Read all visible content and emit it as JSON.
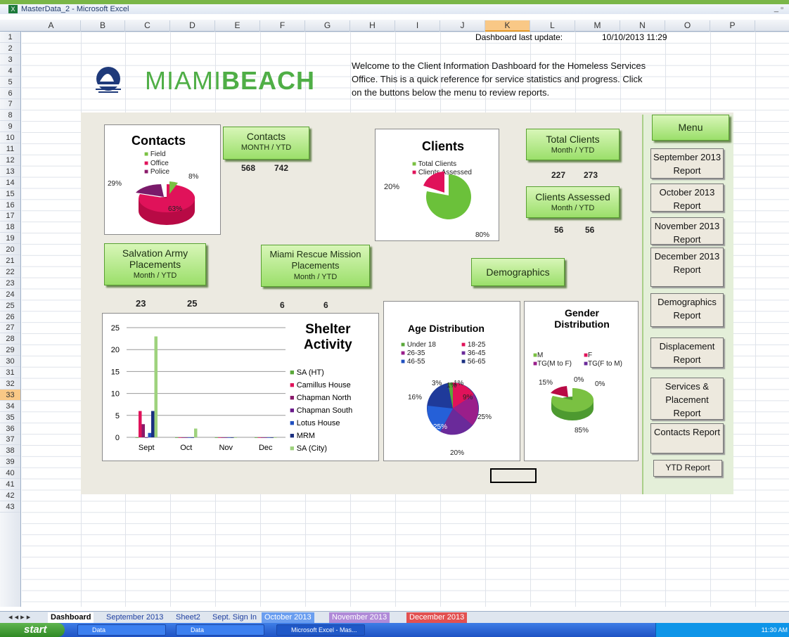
{
  "window": {
    "title": "MasterData_2 - Microsoft Excel"
  },
  "columns": [
    "A",
    "B",
    "C",
    "D",
    "E",
    "F",
    "G",
    "H",
    "I",
    "J",
    "K",
    "L",
    "M",
    "N",
    "O",
    "P"
  ],
  "selected_column": "K",
  "rows": [
    "1",
    "2",
    "3",
    "4",
    "5",
    "6",
    "7",
    "8",
    "9",
    "10",
    "11",
    "12",
    "13",
    "14",
    "15",
    "16",
    "17",
    "18",
    "19",
    "20",
    "21",
    "22",
    "23",
    "24",
    "25",
    "26",
    "27",
    "28",
    "29",
    "30",
    "31",
    "32",
    "33",
    "34",
    "35",
    "36",
    "37",
    "38",
    "39",
    "40",
    "41",
    "42",
    "43"
  ],
  "selected_row": "33",
  "header": {
    "update_label": "Dashboard last update:",
    "update_value": "10/10/2013 11:29",
    "logo_text_a": "MIAMI",
    "logo_text_b": "BEACH",
    "welcome": "Welcome to the Client Information Dashboard for the Homeless Services Office. This is a quick reference for service statistics and progress.  Click on the buttons below the menu to review reports."
  },
  "contacts": {
    "title": "Contacts",
    "legend": [
      "Field",
      "Office",
      "Police"
    ],
    "labels": [
      "8%",
      "63%",
      "29%"
    ],
    "btn_label": "Contacts",
    "btn_sub": "MONTH / YTD",
    "month": "568",
    "ytd": "742"
  },
  "clients": {
    "title": "Clients",
    "legend": [
      "Total Clients",
      "Clients Assessed"
    ],
    "labels": [
      "20%",
      "80%"
    ],
    "total_btn": "Total Clients",
    "total_sub": "Month  /  YTD",
    "total_month": "227",
    "total_ytd": "273",
    "assessed_btn": "Clients Assessed",
    "assessed_sub": "Month  /  YTD",
    "assessed_month": "56",
    "assessed_ytd": "56"
  },
  "salvation": {
    "btn_line1": "Salvation Army",
    "btn_line2": "Placements",
    "btn_sub": "Month  /   YTD",
    "month": "23",
    "ytd": "25"
  },
  "rescue": {
    "btn_line1": "Miami Rescue Mission",
    "btn_line2": "Placements",
    "btn_sub": "Month   /   YTD",
    "month": "6",
    "ytd": "6"
  },
  "demographics_btn": "Demographics",
  "shelter": {
    "title_line1": "Shelter",
    "title_line2": "Activity"
  },
  "age": {
    "title": "Age Distribution",
    "legend": [
      "Under 18",
      "18-25",
      "26-35",
      "36-45",
      "46-55",
      "56-65"
    ],
    "labels": [
      "1%",
      "3%",
      "1%",
      "16%",
      "9%",
      "25%",
      "25%",
      "20%"
    ]
  },
  "gender": {
    "title_line1": "Gender",
    "title_line2": "Distribution",
    "legend": [
      "M",
      "F",
      "TG(M to F)",
      "TG(F to M)"
    ],
    "labels": [
      "15%",
      "0%",
      "0%",
      "85%"
    ]
  },
  "chart_data": {
    "type": "bar",
    "categories": [
      "Sept",
      "Oct",
      "Nov",
      "Dec"
    ],
    "ylim": [
      0,
      25
    ],
    "yticks": [
      "0",
      "5",
      "10",
      "15",
      "20",
      "25"
    ],
    "series": [
      {
        "name": "SA (HT)",
        "color": "#5aa83a",
        "values": [
          0,
          0,
          0,
          0
        ]
      },
      {
        "name": "Camillus House",
        "color": "#e0125a",
        "values": [
          6,
          0,
          0,
          0
        ]
      },
      {
        "name": "Chapman North",
        "color": "#8a1a6a",
        "values": [
          3,
          0,
          0,
          0
        ]
      },
      {
        "name": "Chapman South",
        "color": "#6a1a8a",
        "values": [
          0,
          0,
          0,
          0
        ]
      },
      {
        "name": "Lotus House",
        "color": "#2050c0",
        "values": [
          1,
          0,
          0,
          0
        ]
      },
      {
        "name": "MRM",
        "color": "#1a2f80",
        "values": [
          6,
          0,
          0,
          0
        ]
      },
      {
        "name": "SA (City)",
        "color": "#9ed27d",
        "values": [
          23,
          2,
          0,
          0
        ]
      }
    ]
  },
  "menu": {
    "title": "Menu",
    "items": [
      "September 2013 Report",
      "October 2013 Report",
      "November 2013 Report",
      "December 2013 Report",
      "Demographics Report",
      "Displacement Report",
      "Services & Placement Report",
      "Contacts Report",
      "YTD Report"
    ]
  },
  "sheets": [
    "Dashboard",
    "September 2013",
    "Sheet2",
    "Sept. Sign In",
    "October 2013",
    "November 2013",
    "December 2013"
  ],
  "taskbar": {
    "start": "start",
    "items": [
      "Data",
      "Data",
      "Microsoft Excel - Mas..."
    ],
    "clock": "11:30 AM"
  }
}
